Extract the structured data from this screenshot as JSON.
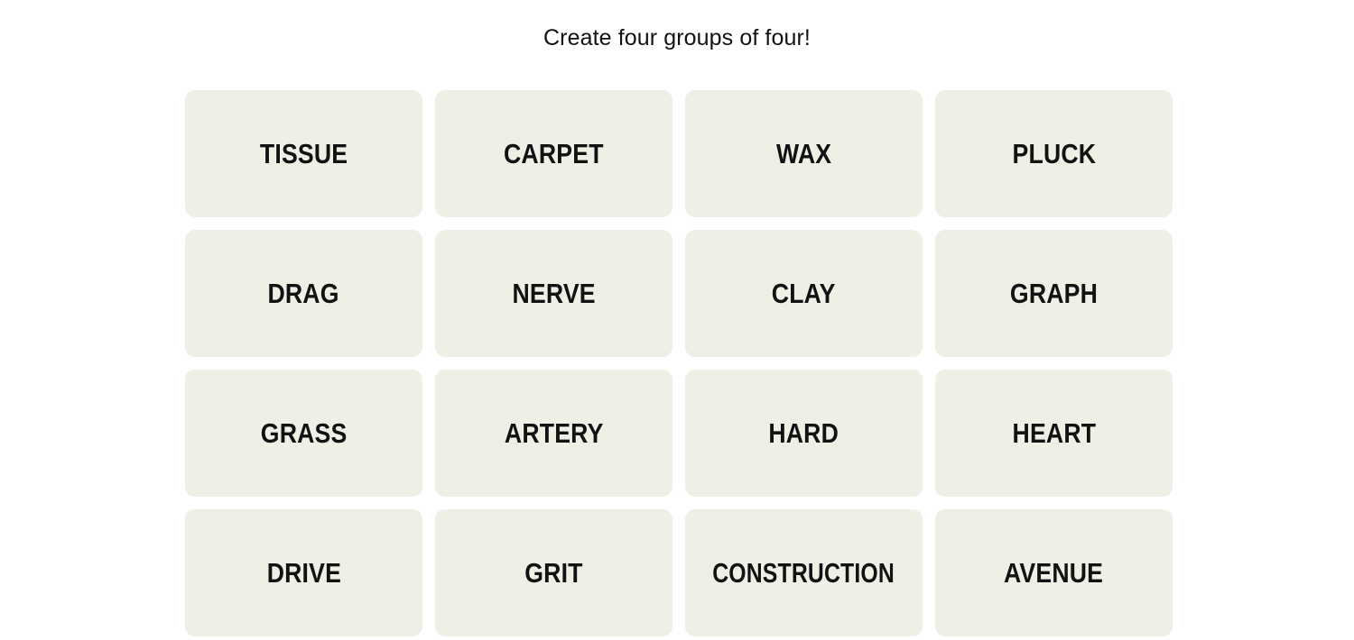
{
  "page": {
    "background_color": "#FFFFFF",
    "title": "Connections"
  },
  "header": {
    "instruction": "Create four groups of four!"
  },
  "board": {
    "rows": 4,
    "columns": 4,
    "tile_background_color": "#EFEFE6",
    "tile_text_color": "#121212",
    "tiles": [
      {
        "label": "TISSUE",
        "row": 1,
        "col": 1,
        "selected": false
      },
      {
        "label": "CARPET",
        "row": 1,
        "col": 2,
        "selected": false
      },
      {
        "label": "WAX",
        "row": 1,
        "col": 3,
        "selected": false
      },
      {
        "label": "PLUCK",
        "row": 1,
        "col": 4,
        "selected": false
      },
      {
        "label": "DRAG",
        "row": 2,
        "col": 1,
        "selected": false
      },
      {
        "label": "NERVE",
        "row": 2,
        "col": 2,
        "selected": false
      },
      {
        "label": "CLAY",
        "row": 2,
        "col": 3,
        "selected": false
      },
      {
        "label": "GRAPH",
        "row": 2,
        "col": 4,
        "selected": false
      },
      {
        "label": "GRASS",
        "row": 3,
        "col": 1,
        "selected": false
      },
      {
        "label": "ARTERY",
        "row": 3,
        "col": 2,
        "selected": false
      },
      {
        "label": "HARD",
        "row": 3,
        "col": 3,
        "selected": false
      },
      {
        "label": "HEART",
        "row": 3,
        "col": 4,
        "selected": false
      },
      {
        "label": "DRIVE",
        "row": 4,
        "col": 1,
        "selected": false
      },
      {
        "label": "GRIT",
        "row": 4,
        "col": 2,
        "selected": false
      },
      {
        "label": "CONSTRUCTION",
        "row": 4,
        "col": 3,
        "selected": false
      },
      {
        "label": "AVENUE",
        "row": 4,
        "col": 4,
        "selected": false
      }
    ]
  }
}
